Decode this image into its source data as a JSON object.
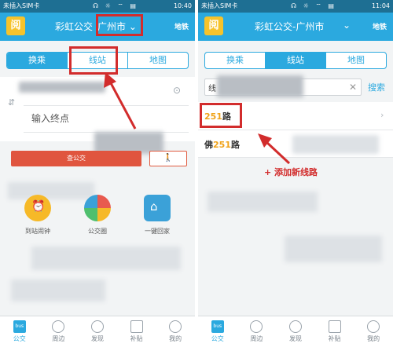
{
  "status": {
    "left": {
      "carrier": "未插入SIM卡",
      "time": "10:40"
    },
    "right": {
      "carrier": "未插入SIM卡",
      "time": "11:04"
    }
  },
  "header": {
    "app_name": "彩虹公交",
    "left_city": "广州市",
    "right_title": "彩虹公交-广州市",
    "metro": "地铁",
    "logo_glyph": "阅"
  },
  "tabs": [
    "换乘",
    "线站",
    "地图"
  ],
  "left": {
    "end_placeholder": "输入终点",
    "query_button": "查公交",
    "quick_links": [
      {
        "label": "到站闹钟",
        "icon": "alarm-icon",
        "color": "#f6b928"
      },
      {
        "label": "公交圈",
        "icon": "circle-icon",
        "color": "#e85a4f"
      },
      {
        "label": "一键回家",
        "icon": "home-icon",
        "color": "#3ba1d8"
      }
    ]
  },
  "right": {
    "search_value": "线",
    "search_button": "搜索",
    "results": [
      {
        "num": "251",
        "suffix": "路",
        "prefix": ""
      },
      {
        "num": "251",
        "suffix": "路",
        "prefix": "佛"
      }
    ],
    "annotation": "+ 添加新线路"
  },
  "bottom_tabs": [
    "公交",
    "周边",
    "发现",
    "补贴",
    "我的"
  ],
  "colors": {
    "primary": "#2ba9df",
    "status_bar": "#1e6f93",
    "highlight": "#d22c2c",
    "accent_orange": "#f0a31a"
  }
}
